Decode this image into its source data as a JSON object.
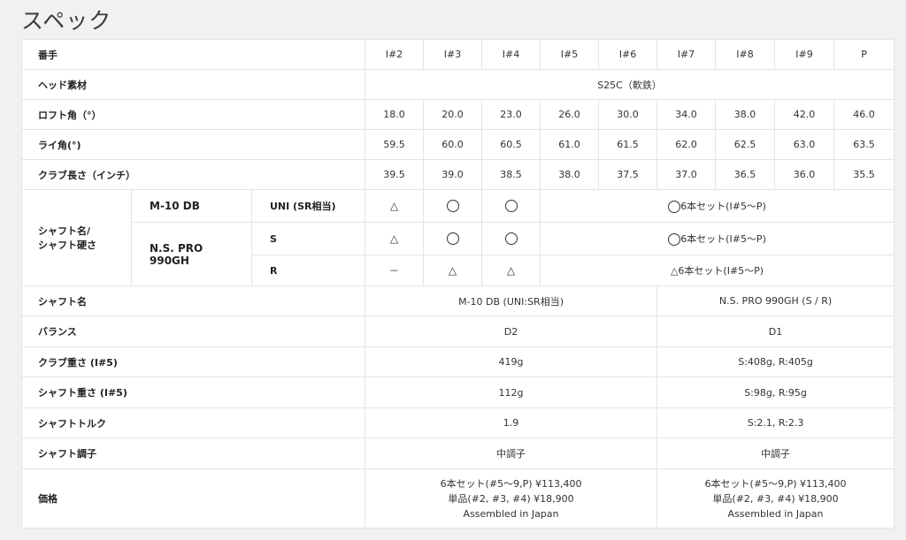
{
  "page_title": "スペック",
  "header": {
    "label": "番手",
    "clubs": [
      "I#2",
      "I#3",
      "I#4",
      "I#5",
      "I#6",
      "I#7",
      "I#8",
      "I#9",
      "P"
    ]
  },
  "head_material": {
    "label": "ヘッド素材",
    "value": "S25C（軟鉄）"
  },
  "loft": {
    "label": "ロフト角（°）",
    "values": [
      "18.0",
      "20.0",
      "23.0",
      "26.0",
      "30.0",
      "34.0",
      "38.0",
      "42.0",
      "46.0"
    ]
  },
  "lie": {
    "label": "ライ角(°)",
    "values": [
      "59.5",
      "60.0",
      "60.5",
      "61.0",
      "61.5",
      "62.0",
      "62.5",
      "63.0",
      "63.5"
    ]
  },
  "length": {
    "label": "クラブ長さ（インチ）",
    "values": [
      "39.5",
      "39.0",
      "38.5",
      "38.0",
      "37.5",
      "37.0",
      "36.5",
      "36.0",
      "35.5"
    ]
  },
  "shaft_avail": {
    "label_line1": "シャフト名/",
    "label_line2": "シャフト硬さ",
    "m10": {
      "name": "M-10 DB",
      "flex": "UNI (SR相当)",
      "i2": "△",
      "set_text": "6本セット(I#5〜P)"
    },
    "ns": {
      "name_line1": "N.S. PRO",
      "name_line2": "990GH",
      "s": {
        "flex": "S",
        "i2": "△",
        "set_text": "6本セット(I#5〜P)"
      },
      "r": {
        "flex": "R",
        "i2": "－",
        "i3": "△",
        "i4": "△",
        "set_text": "△6本セット(I#5〜P)"
      }
    }
  },
  "shaft_name": {
    "label": "シャフト名",
    "a": "M-10 DB (UNI:SR相当)",
    "b": "N.S. PRO 990GH (S / R)"
  },
  "balance": {
    "label": "バランス",
    "a": "D2",
    "b": "D1"
  },
  "club_weight": {
    "label": "クラブ重さ (I#5)",
    "a": "419g",
    "b": "S:408g, R:405g"
  },
  "shaft_weight": {
    "label": "シャフト重さ (I#5)",
    "a": "112g",
    "b": "S:98g, R:95g"
  },
  "torque": {
    "label": "シャフトトルク",
    "a": "1.9",
    "b": "S:2.1, R:2.3"
  },
  "kick": {
    "label": "シャフト調子",
    "a": "中調子",
    "b": "中調子"
  },
  "price": {
    "label": "価格",
    "a": {
      "line1": "6本セット(#5〜9,P) ¥113,400",
      "line2": "単品(#2, #3, #4) ¥18,900",
      "line3": "Assembled in Japan"
    },
    "b": {
      "line1": "6本セット(#5〜9,P) ¥113,400",
      "line2": "単品(#2, #3, #4) ¥18,900",
      "line3": "Assembled in Japan"
    }
  }
}
